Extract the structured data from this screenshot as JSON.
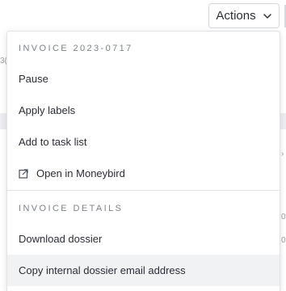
{
  "toolbar": {
    "actions_label": "Actions"
  },
  "menu": {
    "section1_title": "INVOICE 2023-0717",
    "items1": [
      {
        "label": "Pause",
        "icon": null
      },
      {
        "label": "Apply labels",
        "icon": null
      },
      {
        "label": "Add to task list",
        "icon": null
      },
      {
        "label": "Open in Moneybird",
        "icon": "external-link-icon"
      }
    ],
    "section2_title": "INVOICE DETAILS",
    "items2": [
      {
        "label": "Download dossier"
      },
      {
        "label": "Copy internal dossier email address"
      }
    ]
  },
  "colors": {
    "menu_border": "#dfe2e6",
    "section_header": "#7b838c",
    "hover_bg": "#f1f2f4",
    "text": "#2b2f36"
  }
}
